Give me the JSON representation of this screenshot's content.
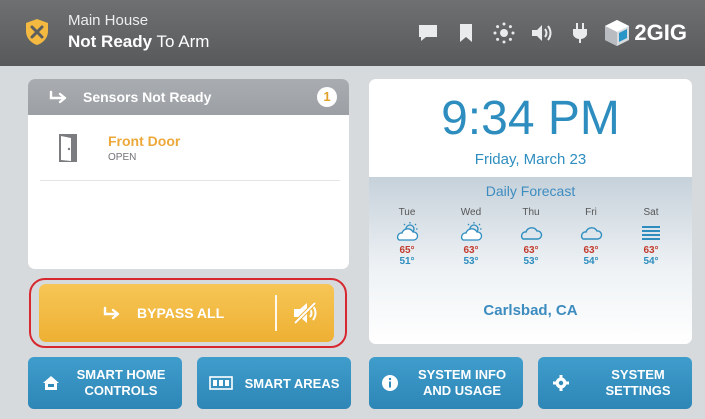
{
  "header": {
    "location": "Main House",
    "status_bold": "Not Ready",
    "status_rest": " To Arm",
    "icons": [
      "shield-x-icon",
      "message-icon",
      "bookmark-icon",
      "brightness-icon",
      "volume-icon",
      "power-plug-icon"
    ],
    "brand": "2GIG"
  },
  "sensors": {
    "title": "Sensors Not Ready",
    "count": "1",
    "items": [
      {
        "name": "Front Door",
        "state": "OPEN",
        "icon": "door-icon"
      }
    ]
  },
  "bypass": {
    "label": "BYPASS ALL",
    "mute_icon": "speaker-mute-icon"
  },
  "clock": {
    "time": "9:34 PM",
    "date": "Friday, March 23",
    "forecast_title": "Daily Forecast",
    "days": [
      {
        "name": "Tue",
        "icon": "partly-sunny-icon",
        "high": "65°",
        "low": "51°"
      },
      {
        "name": "Wed",
        "icon": "partly-sunny-icon",
        "high": "63°",
        "low": "53°"
      },
      {
        "name": "Thu",
        "icon": "cloud-icon",
        "high": "63°",
        "low": "53°"
      },
      {
        "name": "Fri",
        "icon": "cloud-icon",
        "high": "63°",
        "low": "54°"
      },
      {
        "name": "Sat",
        "icon": "fog-icon",
        "high": "63°",
        "low": "54°"
      }
    ],
    "location": "Carlsbad, CA"
  },
  "nav": {
    "smart_home": {
      "line1": "SMART HOME",
      "line2": "CONTROLS"
    },
    "smart_areas": {
      "label": "SMART AREAS"
    },
    "system_info": {
      "line1": "SYSTEM INFO",
      "line2": "AND USAGE"
    },
    "system_settings": {
      "line1": "SYSTEM",
      "line2": "SETTINGS"
    }
  },
  "colors": {
    "accent_blue": "#2d8dbf",
    "warning_orange": "#eda83a",
    "bypass_yellow": "#f2b83f",
    "highlight_red": "#d7282f",
    "header_gray": "#616264"
  }
}
